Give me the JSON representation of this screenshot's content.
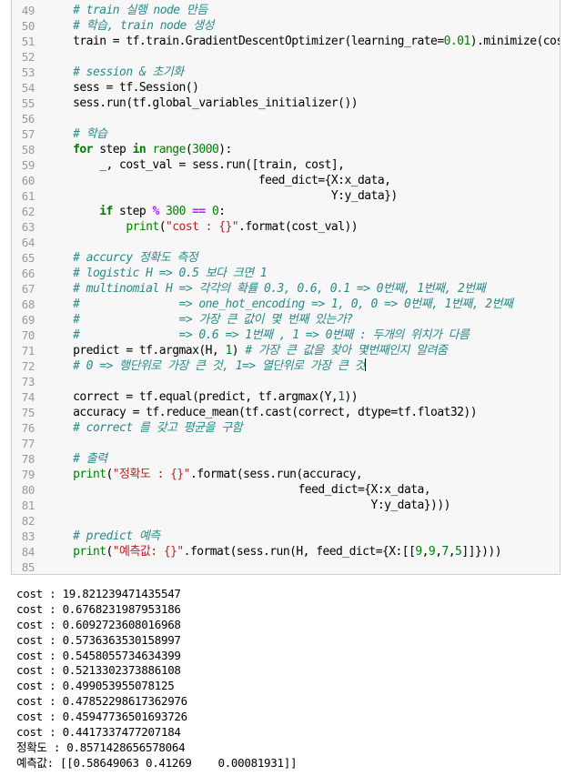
{
  "code_lines": [
    {
      "n": "49",
      "segs": [
        [
          "    ",
          ""
        ],
        [
          "# train 실행 node 만듬",
          "cm"
        ]
      ]
    },
    {
      "n": "50",
      "segs": [
        [
          "    ",
          ""
        ],
        [
          "# 학습, train node 생성",
          "cm"
        ]
      ]
    },
    {
      "n": "51",
      "segs": [
        [
          "    train = tf.train.GradientDescentOptimizer(learning_rate=",
          ""
        ],
        [
          "0.01",
          "nm"
        ],
        [
          ").minimize(cost)",
          ""
        ]
      ]
    },
    {
      "n": "52",
      "segs": []
    },
    {
      "n": "53",
      "segs": [
        [
          "    ",
          ""
        ],
        [
          "# session & 초기화",
          "cm"
        ]
      ]
    },
    {
      "n": "54",
      "segs": [
        [
          "    sess = tf.Session()",
          ""
        ]
      ]
    },
    {
      "n": "55",
      "segs": [
        [
          "    sess.run(tf.global_variables_initializer())",
          ""
        ]
      ]
    },
    {
      "n": "56",
      "segs": []
    },
    {
      "n": "57",
      "segs": [
        [
          "    ",
          ""
        ],
        [
          "# 학습",
          "cm"
        ]
      ]
    },
    {
      "n": "58",
      "segs": [
        [
          "    ",
          ""
        ],
        [
          "for",
          "kw"
        ],
        [
          " step ",
          ""
        ],
        [
          "in",
          "kw"
        ],
        [
          " ",
          ""
        ],
        [
          "range",
          "nm"
        ],
        [
          "(",
          ""
        ],
        [
          "3000",
          "nm"
        ],
        [
          "):",
          ""
        ]
      ]
    },
    {
      "n": "59",
      "segs": [
        [
          "        _, cost_val = sess.run([train, cost],",
          ""
        ]
      ]
    },
    {
      "n": "60",
      "segs": [
        [
          "                                feed_dict={X:x_data,",
          ""
        ]
      ]
    },
    {
      "n": "61",
      "segs": [
        [
          "                                           Y:y_data})",
          ""
        ]
      ]
    },
    {
      "n": "62",
      "segs": [
        [
          "        ",
          ""
        ],
        [
          "if",
          "kw"
        ],
        [
          " step ",
          ""
        ],
        [
          "%",
          "op"
        ],
        [
          " ",
          ""
        ],
        [
          "300",
          "nm"
        ],
        [
          " ",
          ""
        ],
        [
          "==",
          "op"
        ],
        [
          " ",
          ""
        ],
        [
          "0",
          "nm"
        ],
        [
          ":",
          ""
        ]
      ]
    },
    {
      "n": "63",
      "segs": [
        [
          "            ",
          ""
        ],
        [
          "print",
          "nm"
        ],
        [
          "(",
          ""
        ],
        [
          "\"cost : {}\"",
          "st"
        ],
        [
          ".format(cost_val))",
          ""
        ]
      ]
    },
    {
      "n": "64",
      "segs": []
    },
    {
      "n": "65",
      "segs": [
        [
          "    ",
          ""
        ],
        [
          "# accurcy 정확도 측정",
          "cm"
        ]
      ]
    },
    {
      "n": "66",
      "segs": [
        [
          "    ",
          ""
        ],
        [
          "# logistic H => 0.5 보다 크면 1",
          "cm"
        ]
      ]
    },
    {
      "n": "67",
      "segs": [
        [
          "    ",
          ""
        ],
        [
          "# multinomial H => 각각의 확률 0.3, 0.6, 0.1 => 0번째, 1번째, 2번째",
          "cm"
        ]
      ]
    },
    {
      "n": "68",
      "segs": [
        [
          "    ",
          ""
        ],
        [
          "#               => one_hot_encoding => 1, 0, 0 => 0번째, 1번째, 2번째",
          "cm"
        ]
      ]
    },
    {
      "n": "69",
      "segs": [
        [
          "    ",
          ""
        ],
        [
          "#               => 가장 큰 값이 몇 번째 있는가?",
          "cm"
        ]
      ]
    },
    {
      "n": "70",
      "segs": [
        [
          "    ",
          ""
        ],
        [
          "#               => 0.6 => 1번째 , 1 => 0번째 : 두개의 위치가 다름",
          "cm"
        ]
      ]
    },
    {
      "n": "71",
      "segs": [
        [
          "    predict = tf.argmax(H, ",
          ""
        ],
        [
          "1",
          "nm"
        ],
        [
          ") ",
          ""
        ],
        [
          "# 가장 큰 값을 찾아 몇번째인지 알려줌",
          "cm"
        ]
      ]
    },
    {
      "n": "72",
      "segs": [
        [
          "    ",
          ""
        ],
        [
          "# 0 => 행단위로 가장 큰 것, 1=> 열단위로 가장 큰 것",
          "cm"
        ]
      ],
      "cursor": true
    },
    {
      "n": "73",
      "segs": []
    },
    {
      "n": "74",
      "segs": [
        [
          "    correct = tf.equal(predict, tf.argmax(Y,",
          ""
        ],
        [
          "1",
          "nm"
        ],
        [
          "))",
          ""
        ]
      ]
    },
    {
      "n": "75",
      "segs": [
        [
          "    accuracy = tf.reduce_mean(tf.cast(correct, dtype=tf.float32))",
          ""
        ]
      ]
    },
    {
      "n": "76",
      "segs": [
        [
          "    ",
          ""
        ],
        [
          "# correct 를 갖고 평균을 구함",
          "cm"
        ]
      ]
    },
    {
      "n": "77",
      "segs": []
    },
    {
      "n": "78",
      "segs": [
        [
          "    ",
          ""
        ],
        [
          "# 출력",
          "cm"
        ]
      ]
    },
    {
      "n": "79",
      "segs": [
        [
          "    ",
          ""
        ],
        [
          "print",
          "nm"
        ],
        [
          "(",
          ""
        ],
        [
          "\"정확도 : {}\"",
          "st"
        ],
        [
          ".format(sess.run(accuracy,",
          ""
        ]
      ]
    },
    {
      "n": "80",
      "segs": [
        [
          "                                      feed_dict={X:x_data,",
          ""
        ]
      ]
    },
    {
      "n": "81",
      "segs": [
        [
          "                                                 Y:y_data})))",
          ""
        ]
      ]
    },
    {
      "n": "82",
      "segs": []
    },
    {
      "n": "83",
      "segs": [
        [
          "    ",
          ""
        ],
        [
          "# predict 예측",
          "cm"
        ]
      ]
    },
    {
      "n": "84",
      "segs": [
        [
          "    ",
          ""
        ],
        [
          "print",
          "nm"
        ],
        [
          "(",
          ""
        ],
        [
          "\"예측값: {}\"",
          "st"
        ],
        [
          ".format(sess.run(H, feed_dict={X:[[",
          ""
        ],
        [
          "9",
          "nm"
        ],
        [
          ",",
          ""
        ],
        [
          "9",
          "nm"
        ],
        [
          ",",
          ""
        ],
        [
          "7",
          "nm"
        ],
        [
          ",",
          ""
        ],
        [
          "5",
          "nm"
        ],
        [
          "]]})))",
          ""
        ]
      ]
    },
    {
      "n": "85",
      "segs": []
    }
  ],
  "output_lines": [
    "cost : 19.821239471435547",
    "cost : 0.6768231987953186",
    "cost : 0.6092723608016968",
    "cost : 0.5736363530158997",
    "cost : 0.5458055734634399",
    "cost : 0.5213302373886108",
    "cost : 0.499053955078125",
    "cost : 0.47852298617362976",
    "cost : 0.45947736501693726",
    "cost : 0.4417337477207184",
    "정확도 : 0.8571428656578064",
    "예측값: [[0.58649063 0.41269    0.00081931]]"
  ]
}
